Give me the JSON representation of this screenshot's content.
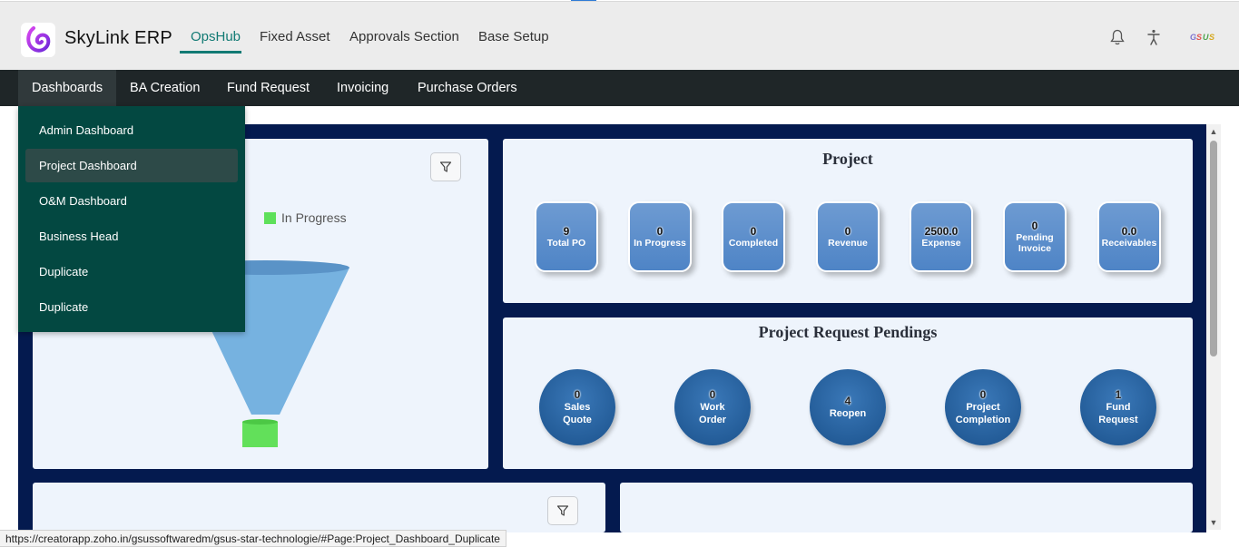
{
  "app": {
    "title": "SkyLink ERP"
  },
  "header": {
    "tabs": [
      {
        "label": "OpsHub"
      },
      {
        "label": "Fixed Asset"
      },
      {
        "label": "Approvals Section"
      },
      {
        "label": "Base Setup"
      }
    ],
    "active_tab": "OpsHub",
    "icons": [
      "bell-icon",
      "accessibility-icon",
      "brand-logo-icon"
    ]
  },
  "subnav": {
    "items": [
      {
        "label": "Dashboards"
      },
      {
        "label": "BA Creation"
      },
      {
        "label": "Fund Request"
      },
      {
        "label": "Invoicing"
      },
      {
        "label": "Purchase Orders"
      }
    ],
    "active": "Dashboards"
  },
  "dropdown": {
    "items": [
      {
        "label": "Admin Dashboard"
      },
      {
        "label": "Project Dashboard"
      },
      {
        "label": "O&M Dashboard"
      },
      {
        "label": "Business Head"
      },
      {
        "label": "Duplicate"
      },
      {
        "label": "Duplicate"
      }
    ],
    "active": "Project Dashboard"
  },
  "funnel_panel": {
    "legend_label": "In Progress",
    "legend_color": "#5ee05a",
    "funnel_color": "#76b2e0"
  },
  "project_panel": {
    "title": "Project",
    "kpis": [
      {
        "value": "9",
        "label": "Total PO"
      },
      {
        "value": "0",
        "label": "In Progress"
      },
      {
        "value": "0",
        "label": "Completed"
      },
      {
        "value": "0",
        "label": "Revenue"
      },
      {
        "value": "2500.0",
        "label": "Expense"
      },
      {
        "value": "0",
        "label": "Pending Invoice"
      },
      {
        "value": "0.0",
        "label": "Receivables"
      }
    ]
  },
  "pending_panel": {
    "title": "Project Request Pendings",
    "items": [
      {
        "value": "0",
        "label": "Sales Quote"
      },
      {
        "value": "0",
        "label": "Work Order"
      },
      {
        "value": "4",
        "label": "Reopen"
      },
      {
        "value": "0",
        "label": "Project Completion"
      },
      {
        "value": "1",
        "label": "Fund Request"
      }
    ]
  },
  "status_bar": {
    "url": "https://creatorapp.zoho.in/gsussoftwaredm/gsus-star-technologie/#Page:Project_Dashboard_Duplicate"
  },
  "colors": {
    "accent": "#127a74",
    "dashboard_bg": "#041a4f",
    "panel_bg": "#eef4fc",
    "dropdown_bg": "#034841",
    "subnav_bg": "#1f2628"
  }
}
